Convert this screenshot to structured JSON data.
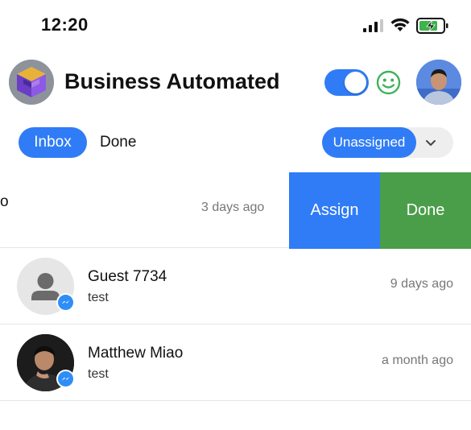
{
  "status_bar": {
    "time": "12:20"
  },
  "header": {
    "title": "Business Automated",
    "toggle_on": true,
    "brand_color": "#2f7cf6",
    "smiley_color": "#3cb45a"
  },
  "tabs": {
    "inbox_label": "Inbox",
    "done_label": "Done"
  },
  "filter": {
    "selected": "Unassigned"
  },
  "conversations": [
    {
      "name_visible": "o",
      "time": "3 days ago",
      "swipe_actions": {
        "assign_label": "Assign",
        "done_label": "Done"
      }
    },
    {
      "name": "Guest 7734",
      "preview": "test",
      "time": "9 days ago",
      "channel_icon": "messenger-icon"
    },
    {
      "name": "Matthew Miao",
      "preview": "test",
      "time": "a month ago",
      "channel_icon": "messenger-icon"
    }
  ],
  "colors": {
    "accent": "#2f7cf6",
    "done_green": "#4a9e4a",
    "muted_text": "#777777"
  }
}
